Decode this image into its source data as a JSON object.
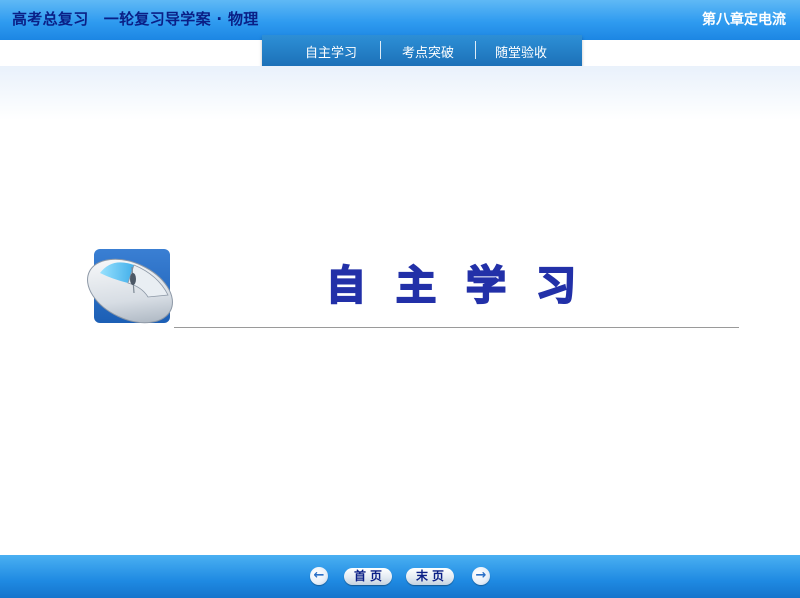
{
  "header": {
    "title": "高考总复习　一轮复习导学案 · 物理",
    "chapter": "第八章定电流"
  },
  "tabs": [
    {
      "label": "自主学习"
    },
    {
      "label": "考点突破"
    },
    {
      "label": "随堂验收"
    }
  ],
  "section": {
    "chars": [
      "自",
      "主",
      "学",
      "习"
    ]
  },
  "footer": {
    "first_label": "首页",
    "last_label": "末页",
    "prev_icon": "left-arrow-icon",
    "next_icon": "right-arrow-icon"
  },
  "colors": {
    "header_blue": "#2f9bf0",
    "title_navy": "#0a1f86",
    "tab_bar": "#1c71b8",
    "section_outline": "#2230a8"
  }
}
